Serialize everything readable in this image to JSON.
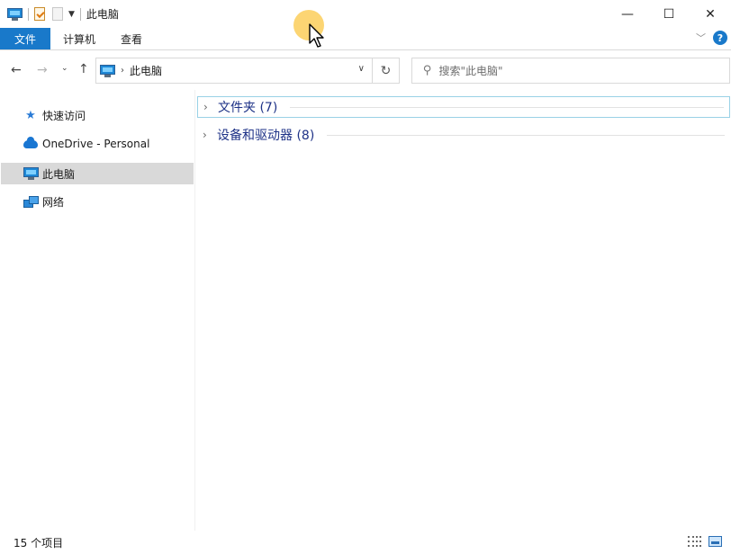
{
  "window": {
    "title": "此电脑",
    "controls": {
      "minimize": "—",
      "maximize": "☐",
      "close": "✕"
    }
  },
  "ribbon": {
    "tabs": [
      "文件",
      "计算机",
      "查看"
    ],
    "help": "?"
  },
  "address": {
    "location": "此电脑",
    "search_placeholder": "搜索\"此电脑\""
  },
  "nav_pane": {
    "items": [
      {
        "label": "快速访问",
        "icon": "star-icon"
      },
      {
        "label": "OneDrive - Personal",
        "icon": "cloud-icon"
      },
      {
        "label": "此电脑",
        "icon": "pc-icon",
        "selected": true
      },
      {
        "label": "网络",
        "icon": "network-icon"
      }
    ]
  },
  "content": {
    "groups": [
      {
        "label": "文件夹 (7)",
        "collapsed": true
      },
      {
        "label": "设备和驱动器 (8)",
        "collapsed": true
      }
    ]
  },
  "status": {
    "item_count": "15 个项目"
  },
  "colors": {
    "accent": "#1979ca",
    "group_label": "#1e3287",
    "selected_bg": "#d9d9d9"
  }
}
